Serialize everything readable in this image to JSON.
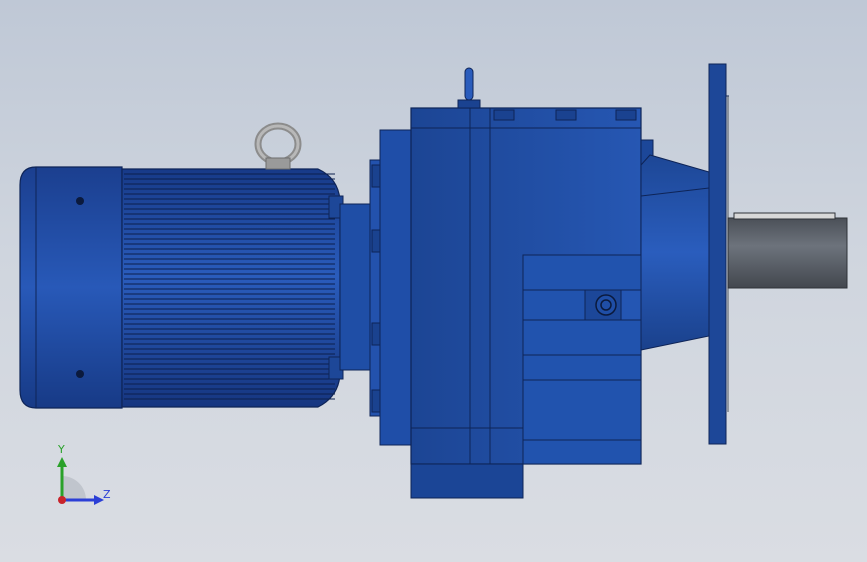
{
  "view": {
    "background_top": "#bfc8d6",
    "background_bottom": "#dadde3",
    "model_color": "#1f4fa8",
    "shaft_color": "#5b616b"
  },
  "model": {
    "parts": [
      "motor-fan-cover",
      "motor-body",
      "lifting-eye",
      "motor-adapter",
      "gearbox-housing",
      "gearbox-flange",
      "output-shaft"
    ]
  },
  "triad": {
    "y_label": "Y",
    "z_label": "Z",
    "y_color": "#2aa12a",
    "z_color": "#2b3fd6",
    "x_color": "#c8242b"
  }
}
